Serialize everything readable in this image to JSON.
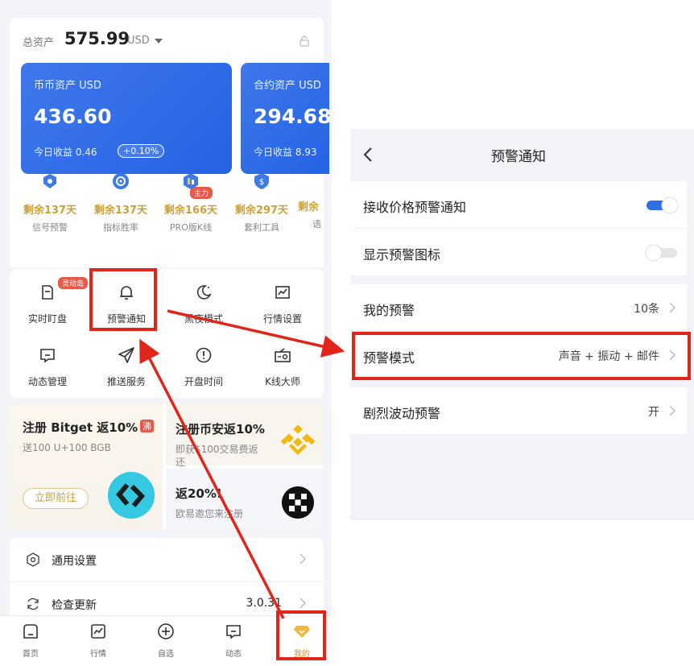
{
  "left": {
    "total": {
      "label": "总资产",
      "value": "575.99",
      "unit": "USD"
    },
    "spot": {
      "label": "币币资产  USD",
      "value": "436.60",
      "earn_label": "今日收益  0.46",
      "earn_badge": "+0.10%"
    },
    "contract": {
      "label": "合约资产  USD",
      "value": "294.68",
      "earn_label": "今日收益  8.93"
    },
    "tools_tag": "主力",
    "tools": [
      {
        "days": "剩余137天",
        "name": "信号预警",
        "icon": "signal-icon"
      },
      {
        "days": "剩余137天",
        "name": "指标胜率",
        "icon": "target-icon"
      },
      {
        "days": "剩余166天",
        "name": "PRO版K线",
        "icon": "chart-badge-icon"
      },
      {
        "days": "剩余297天",
        "name": "套利工具",
        "icon": "dollar-shield-icon"
      },
      {
        "days": "剩余",
        "name": "语",
        "icon": "partial-icon"
      }
    ],
    "menu_tag": "灵动岛",
    "menu": [
      {
        "label": "实时盯盘",
        "icon": "monitor-icon"
      },
      {
        "label": "预警通知",
        "icon": "bell-icon"
      },
      {
        "label": "黑夜模式",
        "icon": "moon-icon"
      },
      {
        "label": "行情设置",
        "icon": "chart-icon"
      },
      {
        "label": "动态管理",
        "icon": "message-icon"
      },
      {
        "label": "推送服务",
        "icon": "send-icon"
      },
      {
        "label": "开盘时间",
        "icon": "clock-icon"
      },
      {
        "label": "K线大师",
        "icon": "radio-icon"
      }
    ],
    "promo": {
      "bitget_title": "注册 Bitget 返10%",
      "bitget_hot": "沸",
      "bitget_sub": "送100 U+100 BGB",
      "bitget_btn": "立即前往",
      "binance_title": "注册币安返10%",
      "binance_sub": "即获$100交易费返还",
      "okx_title": "返20%!",
      "okx_sub": "欧易邀您来注册"
    },
    "settings": [
      {
        "label": "通用设置",
        "value": ""
      },
      {
        "label": "检查更新",
        "value": "3.0.31"
      }
    ],
    "tabs": [
      {
        "label": "首页"
      },
      {
        "label": "行情"
      },
      {
        "label": "自选"
      },
      {
        "label": "动态"
      },
      {
        "label": "我的"
      }
    ]
  },
  "right": {
    "title": "预警通知",
    "rows": {
      "receive": {
        "label": "接收价格预警通知",
        "enabled": true
      },
      "show_icon": {
        "label": "显示预警图标",
        "enabled": false
      },
      "my_alerts": {
        "label": "我的预警",
        "value": "10条"
      },
      "alert_mode": {
        "label": "预警模式",
        "value": "声音 + 振动 + 邮件"
      },
      "volatility": {
        "label": "剧烈波动预警",
        "value": "开"
      }
    }
  },
  "colors": {
    "accent_blue": "#2f6ee8",
    "gold": "#c9a23a",
    "annotation_red": "#e1251b",
    "tag_red": "#e65a4b"
  }
}
